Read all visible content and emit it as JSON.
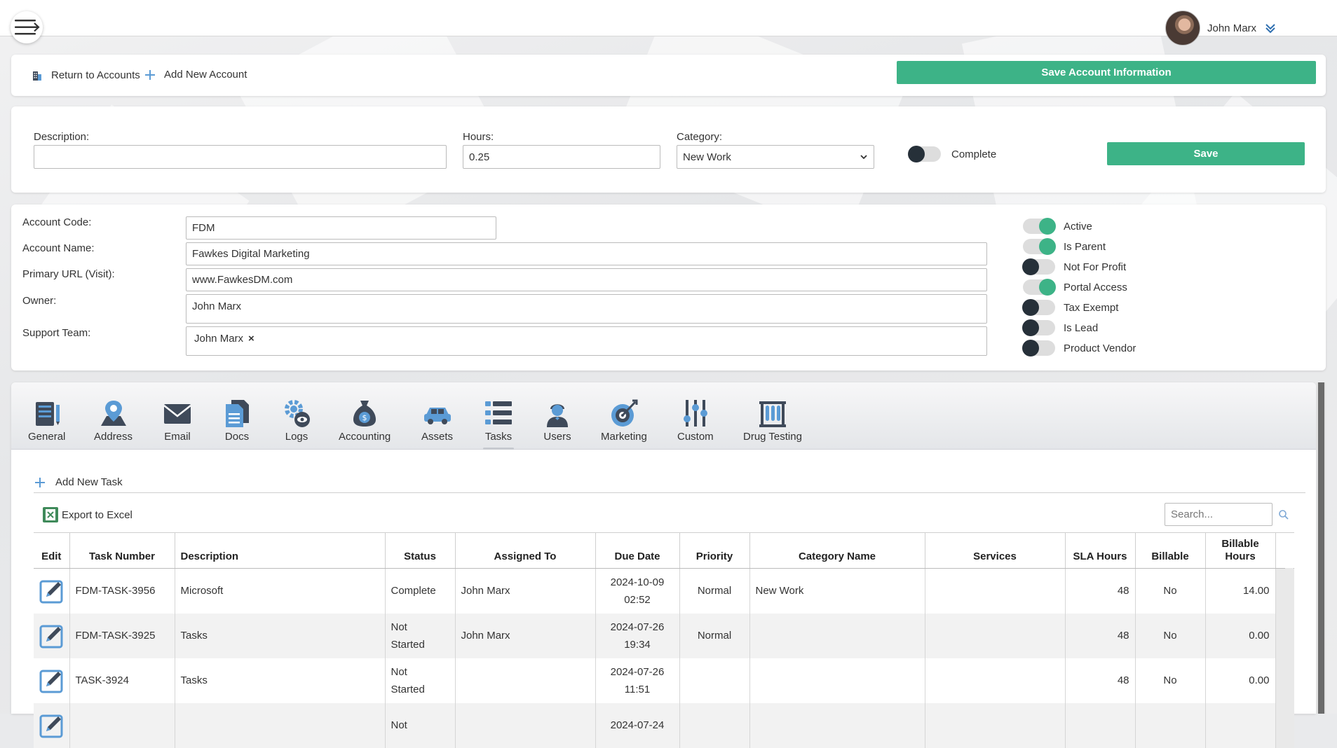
{
  "header": {
    "user_name": "John Marx"
  },
  "toolbar": {
    "return_label": "Return to Accounts",
    "add_account_label": "Add New Account",
    "save_account_label": "Save Account Information"
  },
  "quick_task": {
    "description_label": "Description:",
    "description_value": "",
    "hours_label": "Hours:",
    "hours_value": "0.25",
    "category_label": "Category:",
    "category_value": "New Work",
    "complete_label": "Complete",
    "save_label": "Save"
  },
  "account": {
    "code_label": "Account Code:",
    "code_value": "FDM",
    "name_label": "Account Name:",
    "name_value": "Fawkes Digital Marketing",
    "url_label": "Primary URL (Visit):",
    "url_value": "www.FawkesDM.com",
    "owner_label": "Owner:",
    "owner_value": "John Marx",
    "team_label": "Support Team:",
    "team_member": "John Marx",
    "team_remove": "×"
  },
  "flags": [
    {
      "label": "Active",
      "on": true
    },
    {
      "label": "Is Parent",
      "on": true
    },
    {
      "label": "Not For Profit",
      "on": false
    },
    {
      "label": "Portal Access",
      "on": true
    },
    {
      "label": "Tax Exempt",
      "on": false
    },
    {
      "label": "Is Lead",
      "on": false
    },
    {
      "label": "Product Vendor",
      "on": false
    }
  ],
  "tabs": [
    {
      "label": "General"
    },
    {
      "label": "Address"
    },
    {
      "label": "Email"
    },
    {
      "label": "Docs"
    },
    {
      "label": "Logs"
    },
    {
      "label": "Accounting"
    },
    {
      "label": "Assets"
    },
    {
      "label": "Tasks"
    },
    {
      "label": "Users"
    },
    {
      "label": "Marketing"
    },
    {
      "label": "Custom"
    },
    {
      "label": "Drug Testing"
    }
  ],
  "tasks_panel": {
    "add_task_label": "Add New Task",
    "export_label": "Export to Excel",
    "search_placeholder": "Search..."
  },
  "table": {
    "columns": [
      "Edit",
      "Task Number",
      "Description",
      "Status",
      "Assigned To",
      "Due Date",
      "Priority",
      "Category Name",
      "Services",
      "SLA Hours",
      "Billable",
      "Billable Hours"
    ],
    "rows": [
      {
        "task_number": "FDM-TASK-3956",
        "description": "Microsoft",
        "status": "Complete",
        "assigned_to": "John Marx",
        "due_date": "2024-10-09",
        "due_time": "02:52",
        "priority": "Normal",
        "category": "New Work",
        "services": "",
        "sla": "48",
        "billable": "No",
        "billable_hours": "14.00"
      },
      {
        "task_number": "FDM-TASK-3925",
        "description": "Tasks",
        "status": "Not Started",
        "assigned_to": "John Marx",
        "due_date": "2024-07-26",
        "due_time": "19:34",
        "priority": "Normal",
        "category": "",
        "services": "",
        "sla": "48",
        "billable": "No",
        "billable_hours": "0.00"
      },
      {
        "task_number": "TASK-3924",
        "description": "Tasks",
        "status": "Not Started",
        "assigned_to": "",
        "due_date": "2024-07-26",
        "due_time": "11:51",
        "priority": "",
        "category": "",
        "services": "",
        "sla": "48",
        "billable": "No",
        "billable_hours": "0.00"
      },
      {
        "task_number": "",
        "description": "",
        "status": "Not",
        "assigned_to": "",
        "due_date": "2024-07-24",
        "due_time": "",
        "priority": "",
        "category": "",
        "services": "",
        "sla": "",
        "billable": "",
        "billable_hours": ""
      }
    ]
  },
  "colors": {
    "accent": "#3db387",
    "toggle_off": "#263039",
    "icon_blue": "#5b9bd5",
    "icon_dark": "#3f4a5a"
  }
}
